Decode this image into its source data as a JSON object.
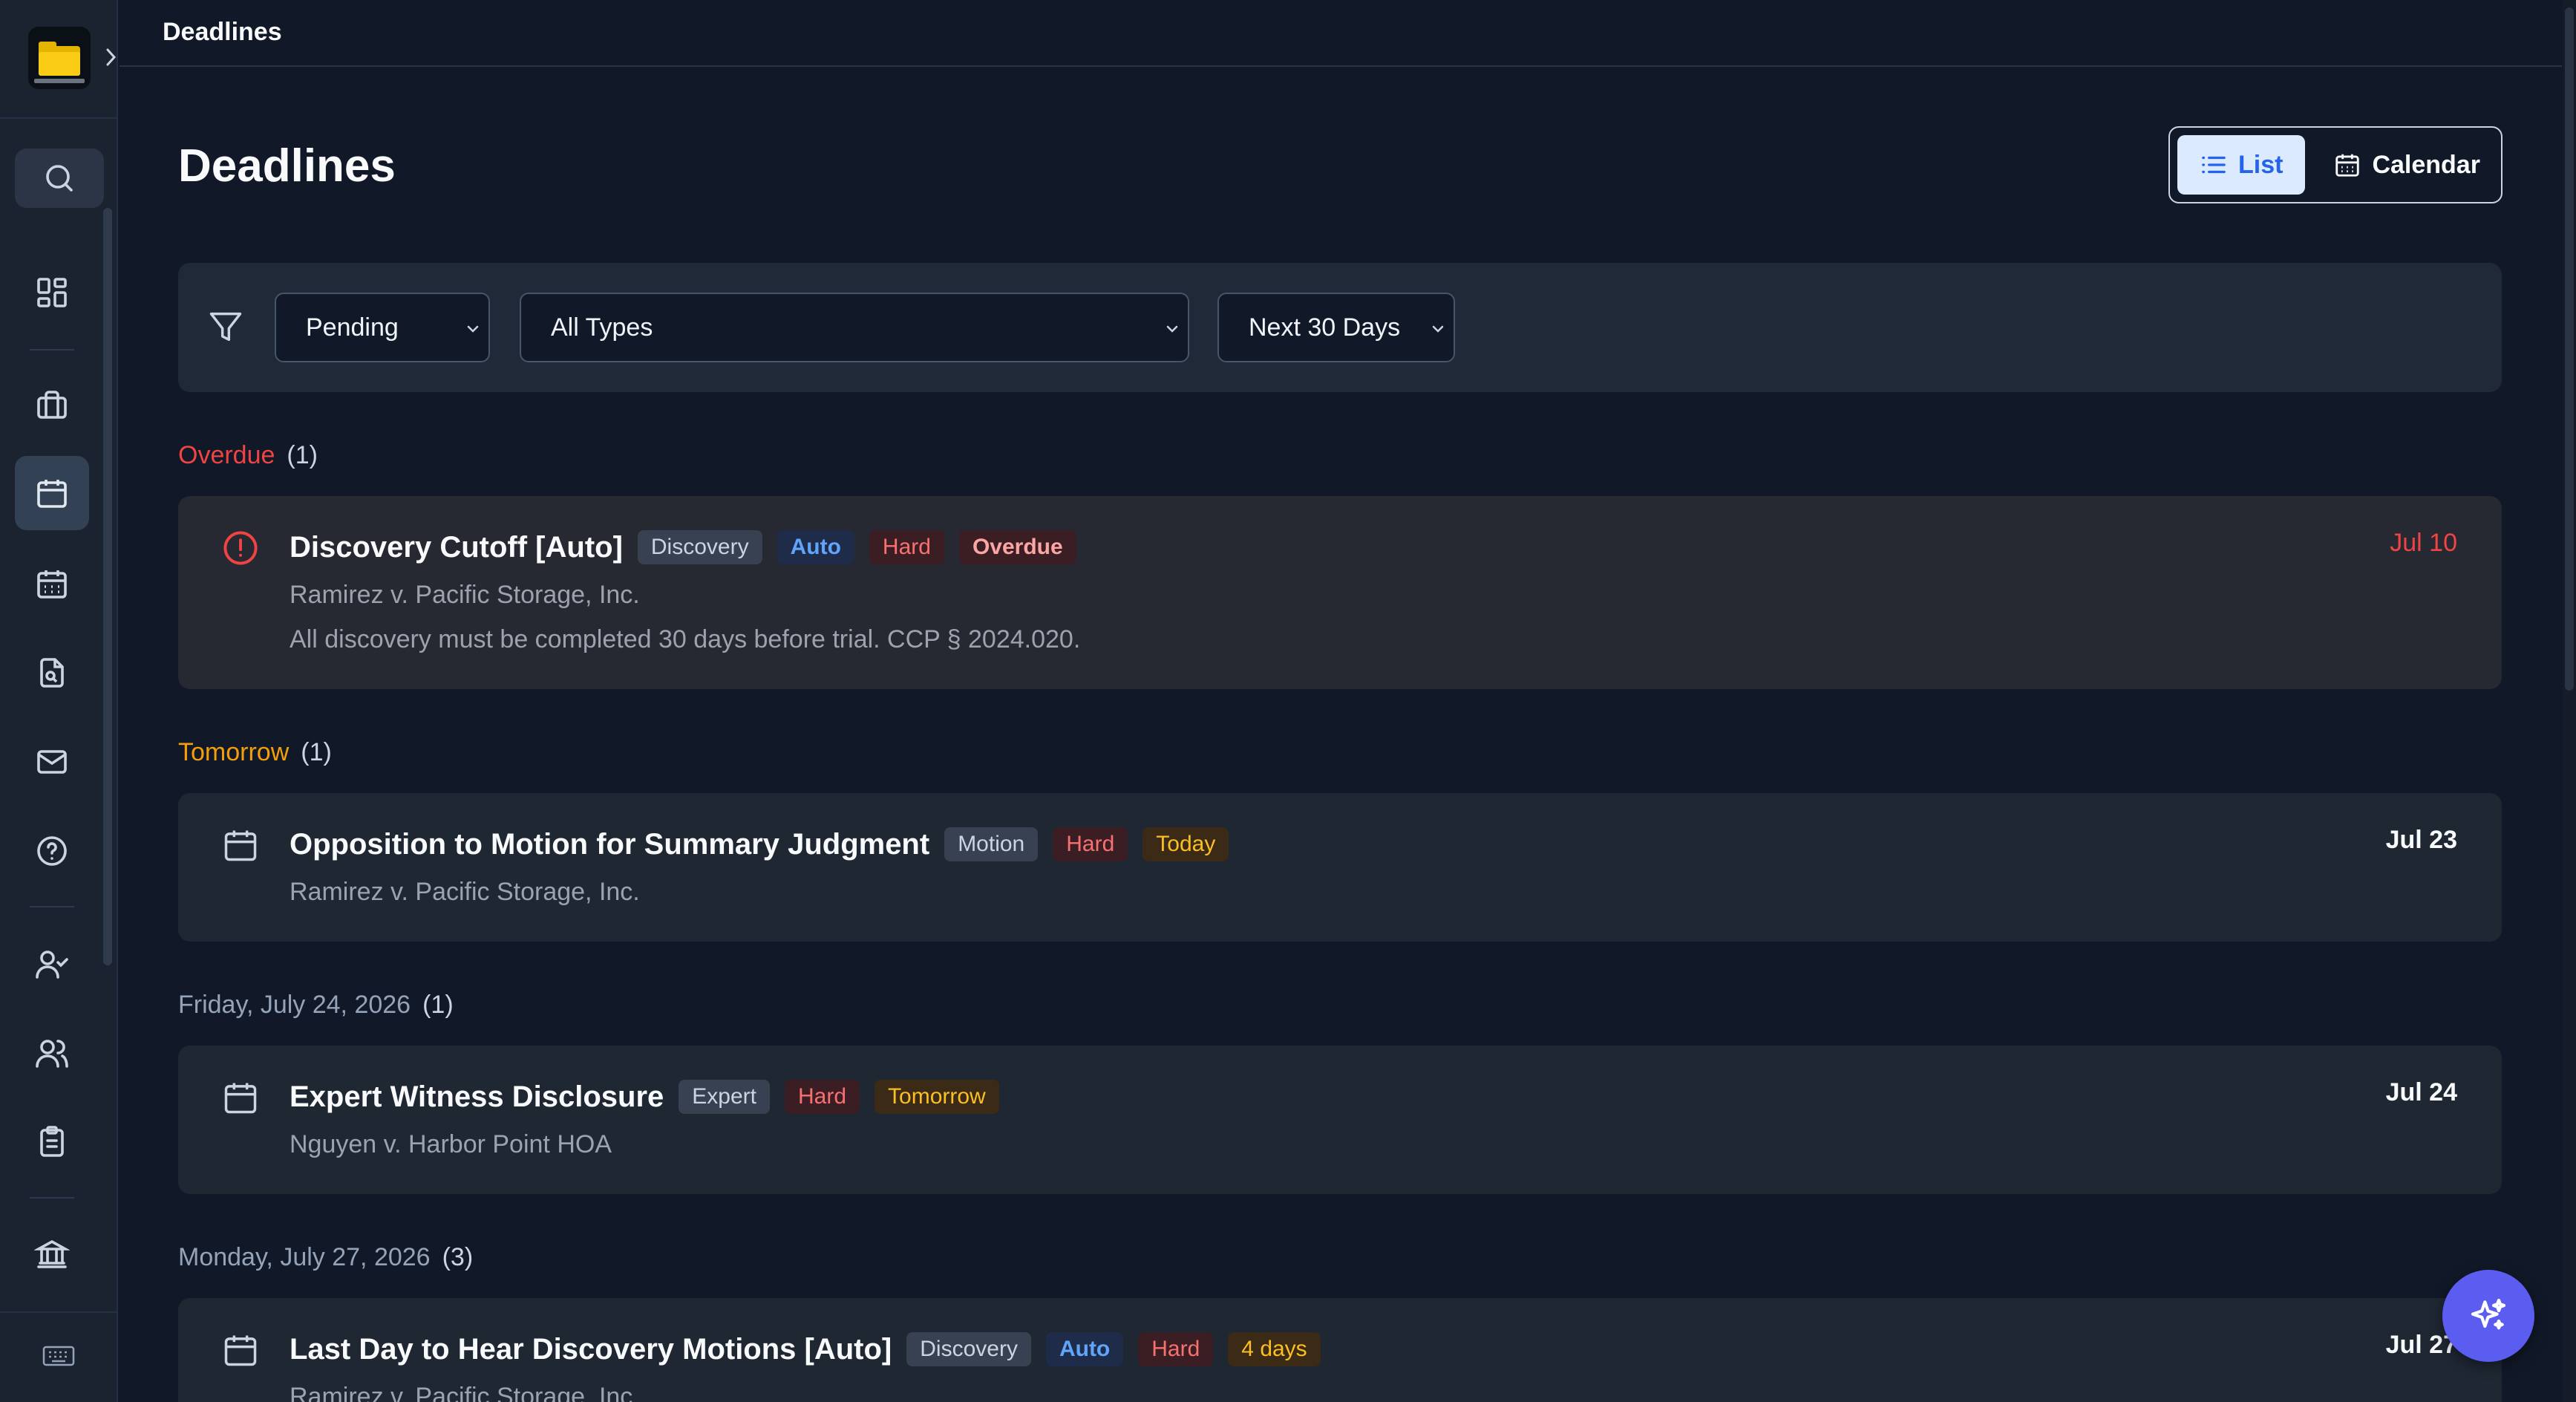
{
  "topbar": {
    "title": "Deadlines"
  },
  "page": {
    "title": "Deadlines"
  },
  "view_toggle": {
    "list_label": "List",
    "calendar_label": "Calendar",
    "active": "List"
  },
  "filters": {
    "status": "Pending",
    "type": "All Types",
    "range": "Next 30 Days"
  },
  "groups": [
    {
      "label": "Overdue",
      "count": "(1)",
      "items": [
        {
          "title": "Discovery Cutoff [Auto]",
          "badges": [
            "Discovery",
            "Auto",
            "Hard",
            "Overdue"
          ],
          "case": "Ramirez v. Pacific Storage, Inc.",
          "note": "All discovery must be completed 30 days before trial. CCP § 2024.020.",
          "date": "Jul 10"
        }
      ]
    },
    {
      "label": "Tomorrow",
      "count": "(1)",
      "items": [
        {
          "title": "Opposition to Motion for Summary Judgment",
          "badges": [
            "Motion",
            "Hard",
            "Today"
          ],
          "case": "Ramirez v. Pacific Storage, Inc.",
          "date": "Jul 23"
        }
      ]
    },
    {
      "label": "Friday, July 24, 2026",
      "count": "(1)",
      "items": [
        {
          "title": "Expert Witness Disclosure",
          "badges": [
            "Expert",
            "Hard",
            "Tomorrow"
          ],
          "case": "Nguyen v. Harbor Point HOA",
          "date": "Jul 24"
        }
      ]
    },
    {
      "label": "Monday, July 27, 2026",
      "count": "(3)",
      "items": [
        {
          "title": "Last Day to Hear Discovery Motions [Auto]",
          "badges": [
            "Discovery",
            "Auto",
            "Hard",
            "4 days"
          ],
          "case": "Ramirez v. Pacific Storage, Inc.",
          "date": "Jul 27"
        }
      ]
    }
  ],
  "colors": {
    "background": "#111827",
    "sidebar": "#1b2330",
    "accent": "#2563eb",
    "overdue": "#ef4444",
    "tomorrow": "#f59e0b",
    "fab": "#5b5cf0"
  },
  "icons": {
    "sidebar": [
      "search-icon",
      "dashboard-icon",
      "briefcase-icon",
      "calendar-icon",
      "calendar-grid-icon",
      "document-search-icon",
      "mail-icon",
      "help-icon",
      "user-check-icon",
      "users-icon",
      "clipboard-icon",
      "bank-icon",
      "keyboard-icon"
    ]
  }
}
